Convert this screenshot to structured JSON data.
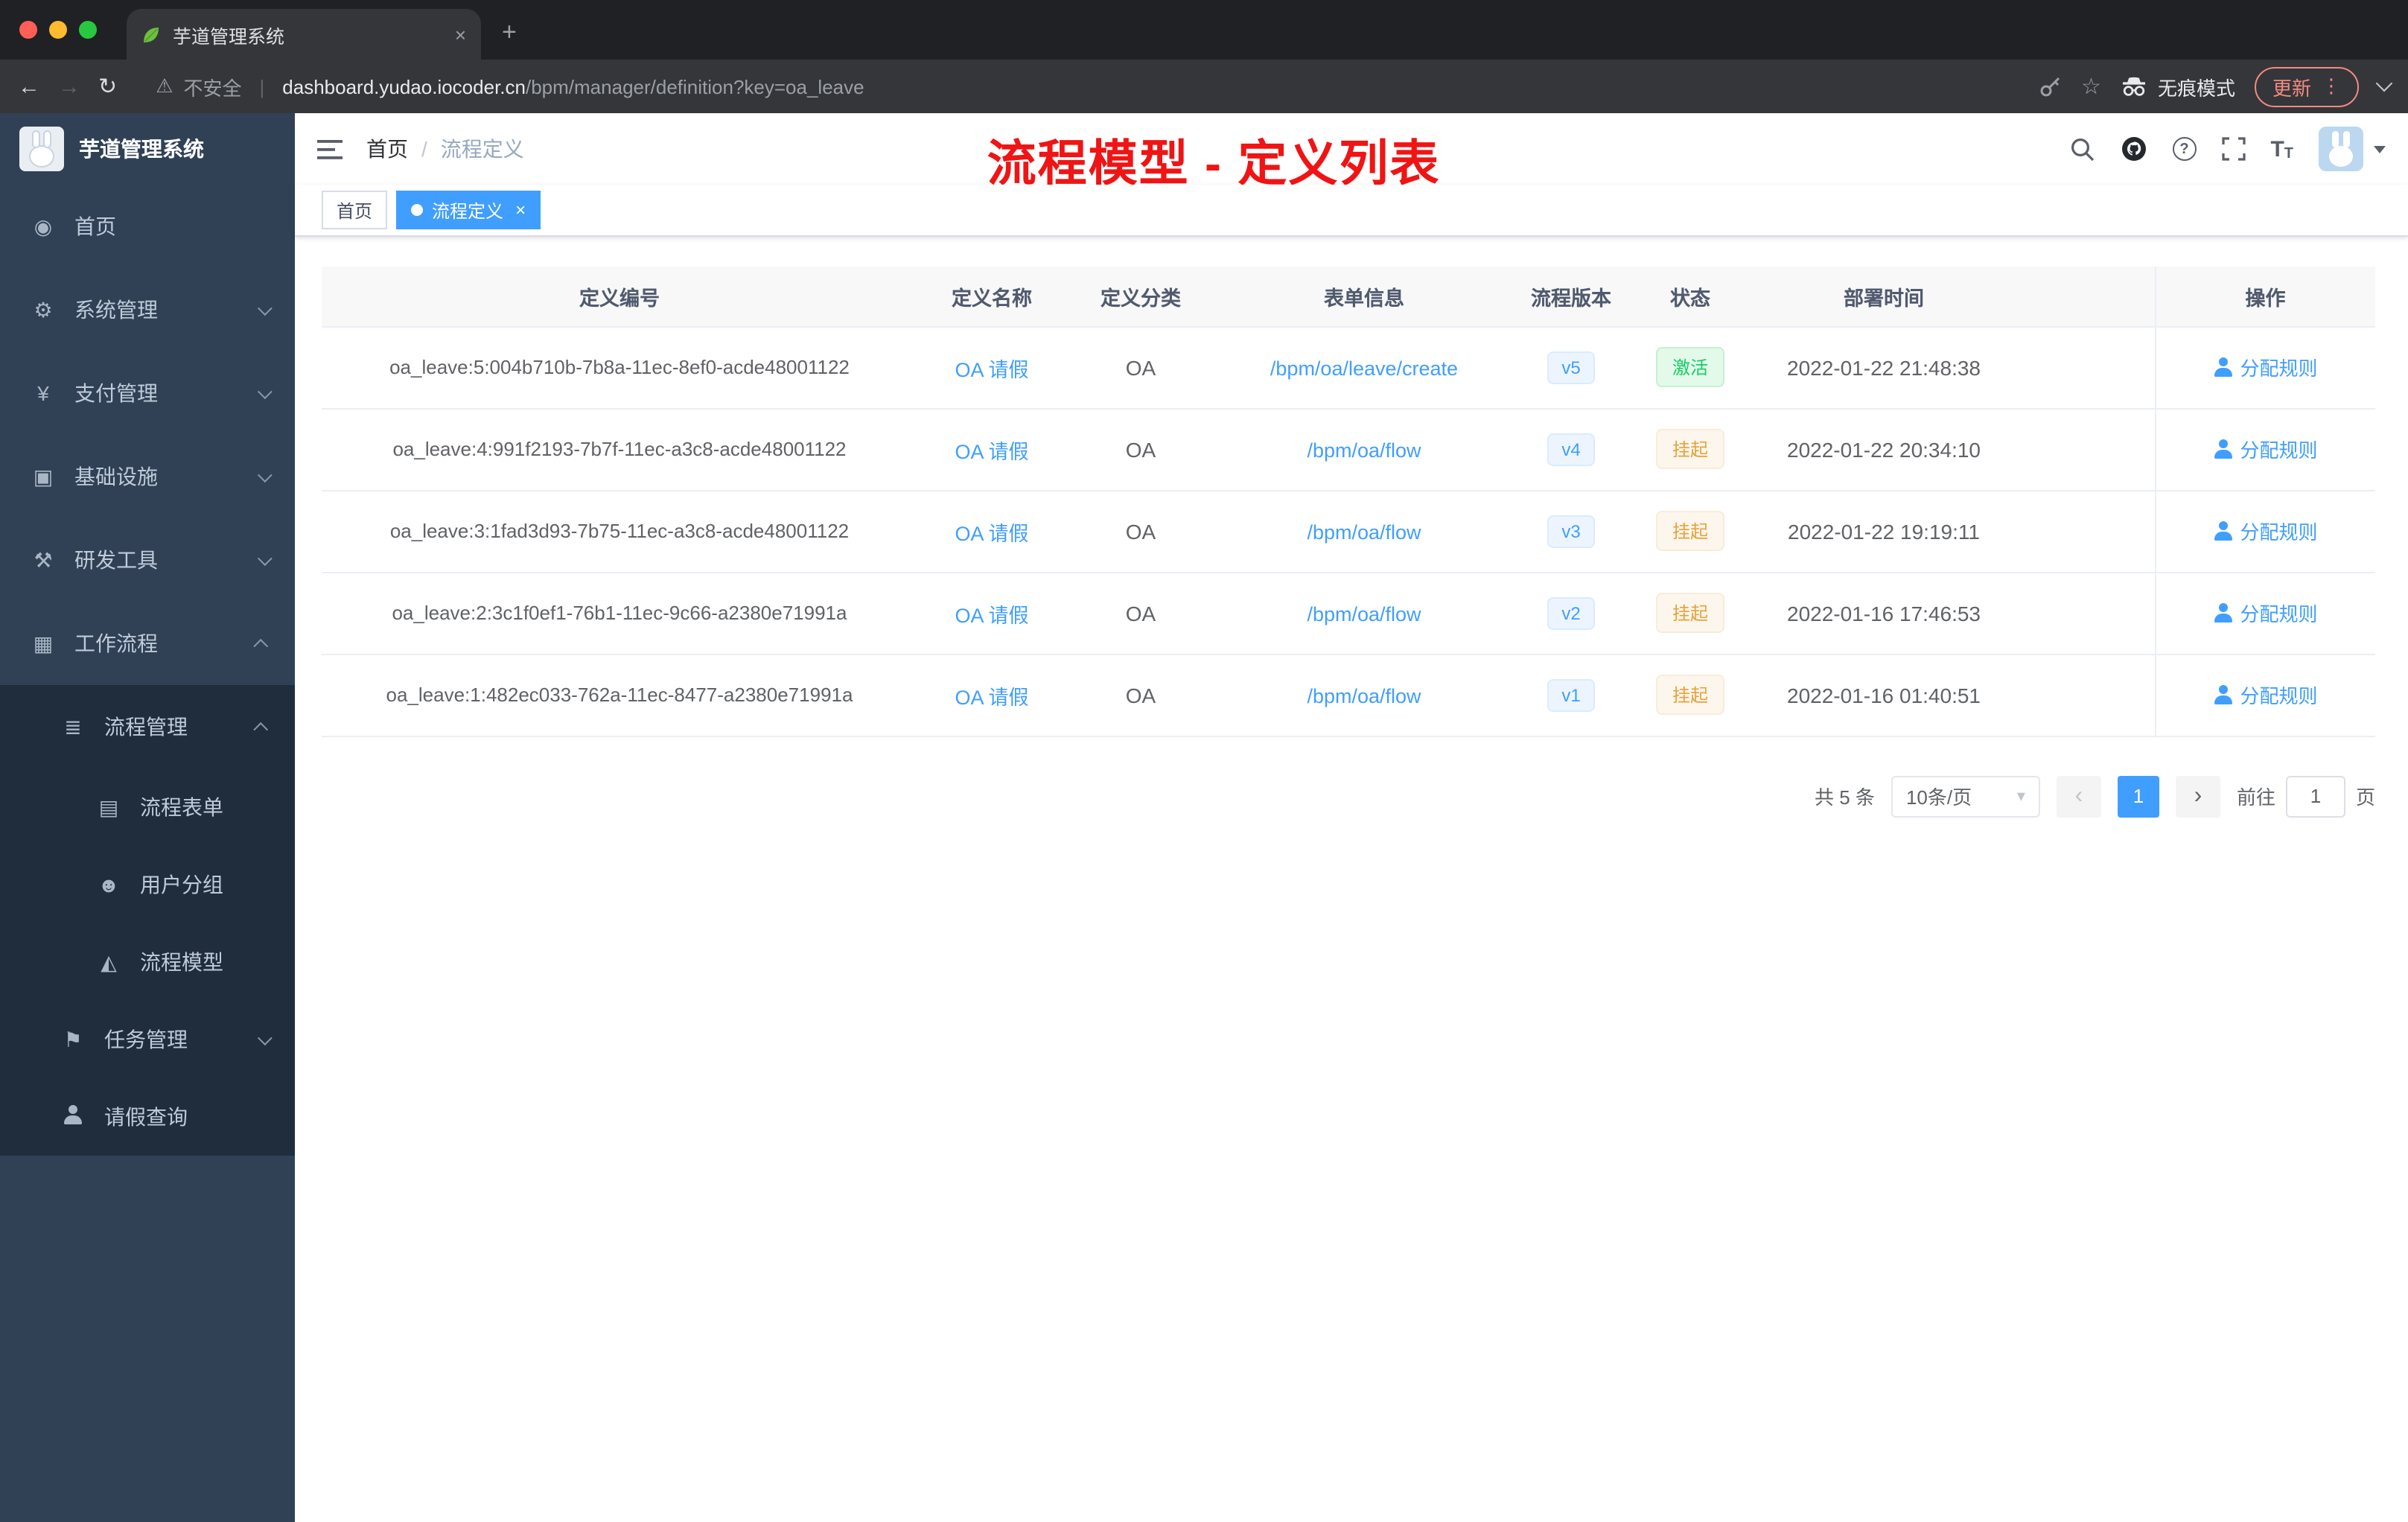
{
  "colors": {
    "accent": "#409eff",
    "annotation_red": "#f01414",
    "status_success": "#13ce66",
    "status_warning": "#e6a23c",
    "sidebar_bg": "#304156",
    "submenu_bg": "#1f2d3d"
  },
  "browser": {
    "tab_title": "芋道管理系统",
    "new_tab": "+",
    "close_tab": "×",
    "back": "←",
    "forward": "→",
    "reload": "↻",
    "security_label": "不安全",
    "separator": "|",
    "url_host": "dashboard.yudao.iocoder.cn",
    "url_path": "/bpm/manager/definition?key=oa_leave",
    "incognito_label": "无痕模式",
    "update_label": "更新"
  },
  "icons": {
    "dashboard": "◉",
    "gear": "⚙",
    "payment": "¥",
    "infrastructure": "▣",
    "tools": "⚒",
    "workflow": "▦",
    "list": "≣",
    "form": "▤",
    "group": "☻",
    "model": "◭",
    "task": "⚑",
    "star": "☆",
    "warning": "⚠",
    "dots": "⋮",
    "caret": "▾"
  },
  "sidebar": {
    "logo_title": "芋道管理系统",
    "items": [
      {
        "label": "首页"
      },
      {
        "label": "系统管理"
      },
      {
        "label": "支付管理"
      },
      {
        "label": "基础设施"
      },
      {
        "label": "研发工具"
      },
      {
        "label": "工作流程"
      },
      {
        "label": "流程管理"
      },
      {
        "label": "流程表单"
      },
      {
        "label": "用户分组"
      },
      {
        "label": "流程模型"
      },
      {
        "label": "任务管理"
      },
      {
        "label": "请假查询"
      }
    ]
  },
  "header": {
    "breadcrumb_home": "首页",
    "breadcrumb_separator": "/",
    "breadcrumb_current": "流程定义",
    "annotation": "流程模型 - 定义列表"
  },
  "tags": {
    "home": "首页",
    "active": "流程定义",
    "close": "×"
  },
  "table": {
    "columns": [
      "定义编号",
      "定义名称",
      "定义分类",
      "表单信息",
      "流程版本",
      "状态",
      "部署时间",
      "操作"
    ],
    "rows": [
      {
        "id": "oa_leave:5:004b710b-7b8a-11ec-8ef0-acde48001122",
        "name": "OA 请假",
        "category": "OA",
        "form": "/bpm/oa/leave/create",
        "version": "v5",
        "status": "激活",
        "time": "2022-01-22 21:48:38",
        "action": "分配规则"
      },
      {
        "id": "oa_leave:4:991f2193-7b7f-11ec-a3c8-acde48001122",
        "name": "OA 请假",
        "category": "OA",
        "form": "/bpm/oa/flow",
        "version": "v4",
        "status": "挂起",
        "time": "2022-01-22 20:34:10",
        "action": "分配规则"
      },
      {
        "id": "oa_leave:3:1fad3d93-7b75-11ec-a3c8-acde48001122",
        "name": "OA 请假",
        "category": "OA",
        "form": "/bpm/oa/flow",
        "version": "v3",
        "status": "挂起",
        "time": "2022-01-22 19:19:11",
        "action": "分配规则"
      },
      {
        "id": "oa_leave:2:3c1f0ef1-76b1-11ec-9c66-a2380e71991a",
        "name": "OA 请假",
        "category": "OA",
        "form": "/bpm/oa/flow",
        "version": "v2",
        "status": "挂起",
        "time": "2022-01-16 17:46:53",
        "action": "分配规则"
      },
      {
        "id": "oa_leave:1:482ec033-762a-11ec-8477-a2380e71991a",
        "name": "OA 请假",
        "category": "OA",
        "form": "/bpm/oa/flow",
        "version": "v1",
        "status": "挂起",
        "time": "2022-01-16 01:40:51",
        "action": "分配规则"
      }
    ]
  },
  "pagination": {
    "total": "共 5 条",
    "page_size": "10条/页",
    "prev": "‹",
    "current": "1",
    "next": "›",
    "goto_label": "前往",
    "goto_value": "1",
    "goto_unit": "页"
  }
}
